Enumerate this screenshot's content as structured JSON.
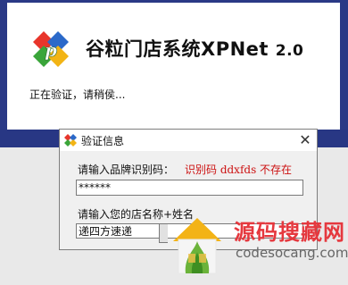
{
  "splash": {
    "app_title": "谷粒门店系统XPNet",
    "version": "2.0",
    "loading_text": "正在验证，请稍侯..."
  },
  "dialog": {
    "title": "验证信息",
    "close_label": "✕",
    "brand_code_label": "请输入品牌识别码：",
    "brand_code_error": "识别码 ddxfds 不存在",
    "brand_code_value": "******",
    "store_label": "请输入您的店名称+姓名",
    "store_value": "递四方速递"
  },
  "watermark": {
    "site_name": "源码搜藏网",
    "site_url": "codesocang.com"
  },
  "colors": {
    "desktop_blue": "#2a3986",
    "error_red": "#cc1111",
    "watermark_red": "#e5383e"
  },
  "icons": [
    "xp-logo-icon",
    "dialog-app-icon",
    "close-icon",
    "house-watermark-icon"
  ]
}
